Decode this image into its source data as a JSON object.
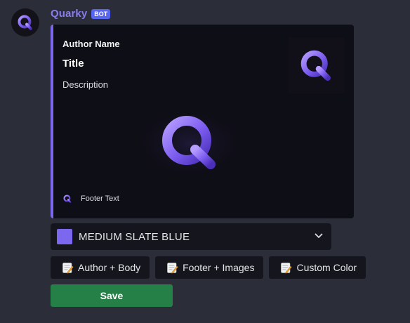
{
  "message": {
    "bot_name": "Quarky",
    "bot_tag": "BOT",
    "accent_color": "#7b68ee",
    "bot_name_color": "#8b7bf0",
    "bot_tag_color": "#5865f2"
  },
  "embed": {
    "author_name": "Author Name",
    "title": "Title",
    "description": "Description",
    "footer_text": "Footer Text",
    "border_color": "#7b68ee"
  },
  "color_select": {
    "selected_label": "MEDIUM SLATE BLUE",
    "selected_color": "#7b68ee",
    "icon": "chevron-down-icon"
  },
  "buttons": [
    {
      "label": "Author + Body",
      "icon": "memo-icon"
    },
    {
      "label": "Footer + Images",
      "icon": "memo-icon"
    },
    {
      "label": "Custom Color",
      "icon": "memo-icon"
    }
  ],
  "save": {
    "label": "Save",
    "color": "#248046"
  }
}
